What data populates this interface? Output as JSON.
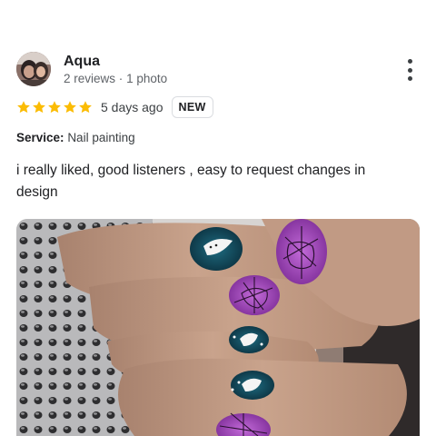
{
  "review": {
    "author": "Aqua",
    "reviews_count": "2 reviews",
    "separator": "·",
    "photos_count": "1 photo",
    "rating": 5,
    "rating_max": 5,
    "date": "5 days ago",
    "badge": "NEW",
    "service_label": "Service:",
    "service_value": "Nail painting",
    "text": "i really liked, good listeners , easy to request changes in design"
  },
  "colors": {
    "star": "#fbbc04",
    "muted_text": "#5f6368",
    "badge_border": "#dadce0"
  },
  "icons": {
    "menu": "more-vertical-icon",
    "star": "star-icon"
  }
}
